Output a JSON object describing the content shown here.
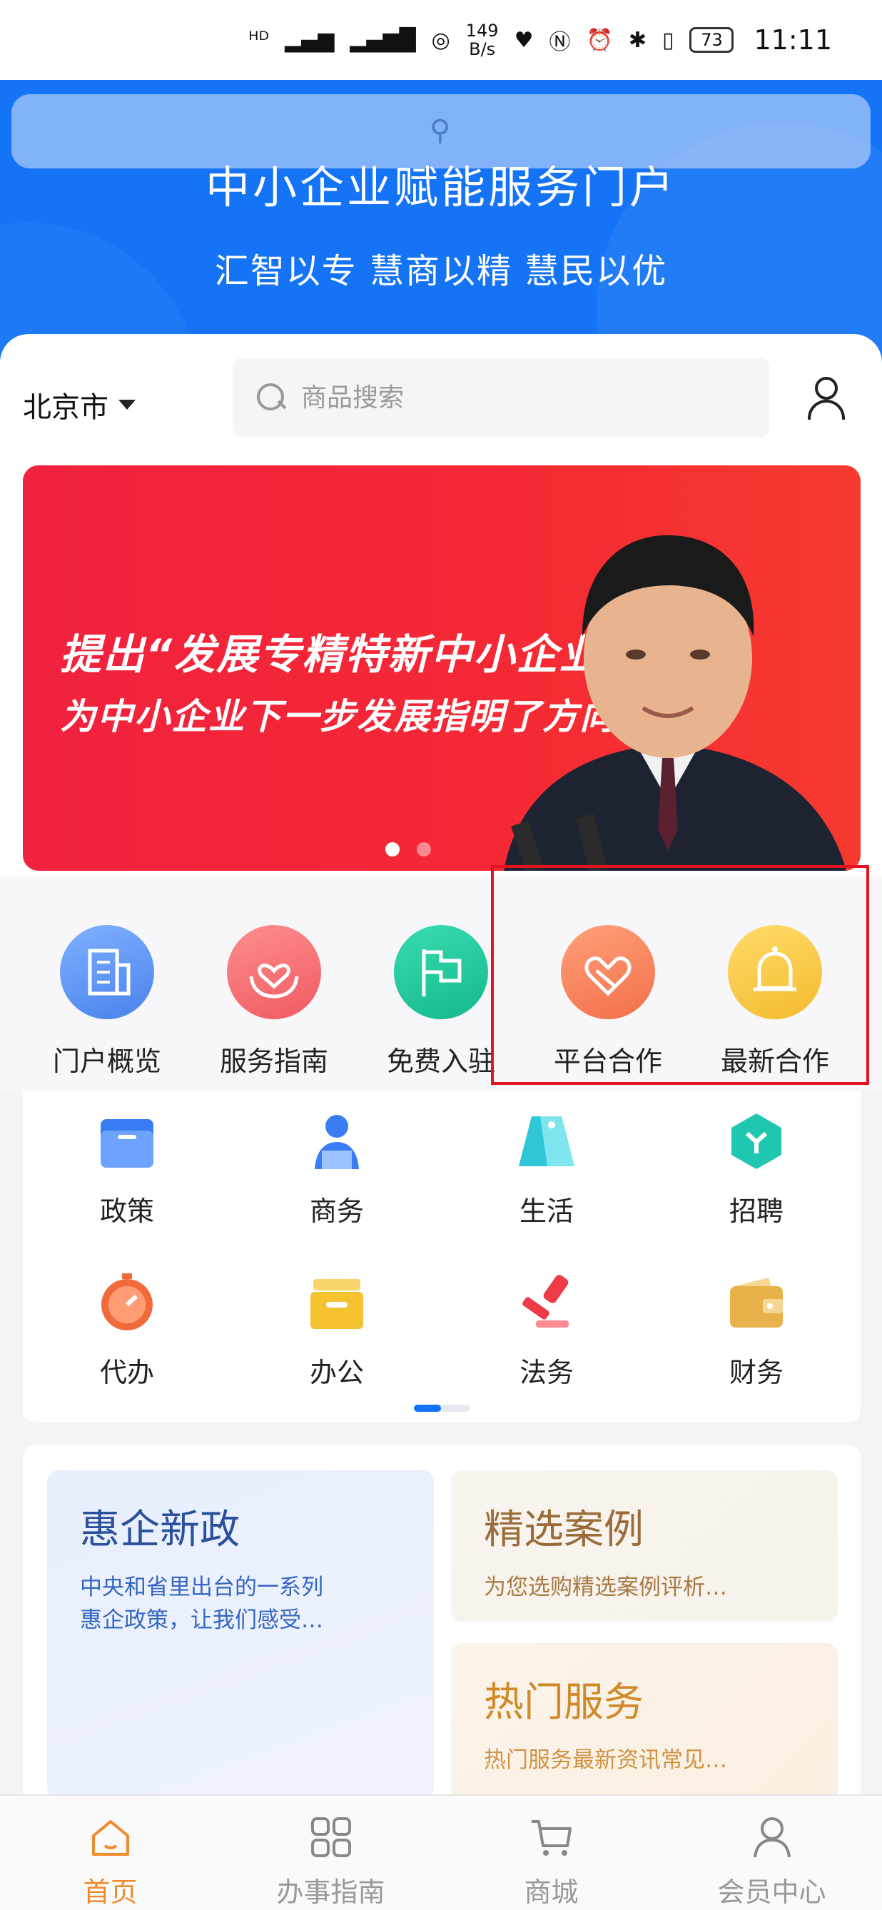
{
  "status_bar": {
    "network_speed_value": "149",
    "network_speed_unit": "B/s",
    "battery": "73",
    "time": "11:11"
  },
  "header": {
    "title": "中小企业赋能服务门户",
    "slogan": "汇智以专 慧商以精 慧民以优"
  },
  "location": {
    "city": "北京市"
  },
  "search": {
    "placeholder": "商品搜索"
  },
  "banner": {
    "line1": "提出“发展专精特新中小企业”，",
    "line2": "为中小企业下一步发展指明了方向",
    "slide_count": 2,
    "active_slide": 1
  },
  "quick_entries": [
    {
      "label": "门户概览",
      "icon": "building-icon",
      "color": "#5b8ff0"
    },
    {
      "label": "服务指南",
      "icon": "heart-hands-icon",
      "color": "#f2676b"
    },
    {
      "label": "免费入驻",
      "icon": "flag-icon",
      "color": "#23c59a"
    },
    {
      "label": "平台合作",
      "icon": "cooperation-icon",
      "color": "#f6875f"
    },
    {
      "label": "最新合作",
      "icon": "bell-icon",
      "color": "#f7c53a"
    }
  ],
  "categories": [
    {
      "label": "政策",
      "icon": "folder-icon",
      "color": "#3a7cf3"
    },
    {
      "label": "商务",
      "icon": "businessman-icon",
      "color": "#3a7cf3"
    },
    {
      "label": "生活",
      "icon": "tag-icon",
      "color": "#2fc6d8"
    },
    {
      "label": "招聘",
      "icon": "hexagon-icon",
      "color": "#20c7b0"
    },
    {
      "label": "代办",
      "icon": "timer-icon",
      "color": "#f06a3c"
    },
    {
      "label": "办公",
      "icon": "archive-icon",
      "color": "#f5c230"
    },
    {
      "label": "法务",
      "icon": "stamp-icon",
      "color": "#ee3b47"
    },
    {
      "label": "财务",
      "icon": "wallet-icon",
      "color": "#e7b24a"
    }
  ],
  "grid_page": {
    "current": 1,
    "total": 2
  },
  "features": {
    "policy": {
      "title": "惠企新政",
      "desc_line1": "中央和省里出台的一系列",
      "desc_line2": "惠企政策，让我们感受…"
    },
    "cases": {
      "title": "精选案例",
      "desc": "为您选购精选案例评析…"
    },
    "hot": {
      "title": "热门服务",
      "desc": "热门服务最新资讯常见…"
    }
  },
  "tabs": [
    {
      "label": "首页",
      "icon": "home-icon",
      "active": true
    },
    {
      "label": "办事指南",
      "icon": "grid-icon",
      "active": false
    },
    {
      "label": "商城",
      "icon": "cart-icon",
      "active": false
    },
    {
      "label": "会员中心",
      "icon": "member-icon",
      "active": false
    }
  ],
  "colors": {
    "brand_blue": "#1474f5",
    "active_tab": "#f08b2c",
    "highlight_box": "#e5131f",
    "banner_red": "#f52835"
  }
}
